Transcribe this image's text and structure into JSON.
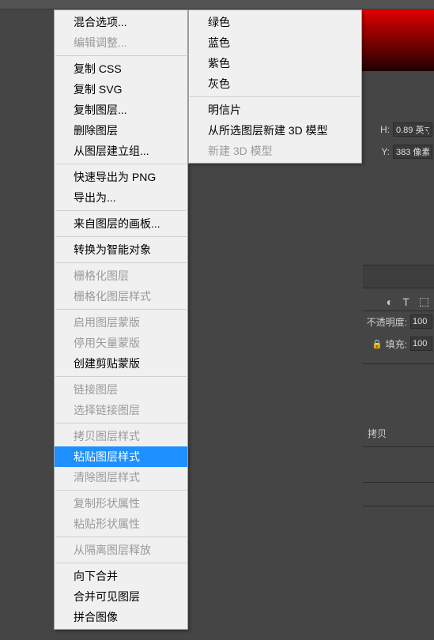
{
  "right_panel": {
    "h_label": "H:",
    "h_value": "0.89 英寸",
    "y_label": "Y:",
    "y_value": "383 像素",
    "opacity_label": "不透明度:",
    "opacity_value": "100",
    "fill_label": "填充:",
    "fill_value": "100",
    "copy_label": "拷贝",
    "icons": {
      "adjust": "◐",
      "text": "T",
      "crop": "⬚"
    }
  },
  "lock_icon": "🔒",
  "menu1": {
    "items": [
      {
        "label": "混合选项...",
        "enabled": true
      },
      {
        "label": "编辑调整...",
        "enabled": false
      }
    ],
    "group2": [
      {
        "label": "复制 CSS",
        "enabled": true
      },
      {
        "label": "复制 SVG",
        "enabled": true
      },
      {
        "label": "复制图层...",
        "enabled": true
      },
      {
        "label": "删除图层",
        "enabled": true
      },
      {
        "label": "从图层建立组...",
        "enabled": true
      }
    ],
    "group3": [
      {
        "label": "快速导出为 PNG",
        "enabled": true
      },
      {
        "label": "导出为...",
        "enabled": true
      }
    ],
    "group4": [
      {
        "label": "来自图层的画板...",
        "enabled": true
      }
    ],
    "group5": [
      {
        "label": "转换为智能对象",
        "enabled": true
      }
    ],
    "group6": [
      {
        "label": "栅格化图层",
        "enabled": false
      },
      {
        "label": "栅格化图层样式",
        "enabled": false
      }
    ],
    "group7": [
      {
        "label": "启用图层蒙版",
        "enabled": false
      },
      {
        "label": "停用矢量蒙版",
        "enabled": false
      },
      {
        "label": "创建剪贴蒙版",
        "enabled": true
      }
    ],
    "group8": [
      {
        "label": "链接图层",
        "enabled": false
      },
      {
        "label": "选择链接图层",
        "enabled": false
      }
    ],
    "group9": [
      {
        "label": "拷贝图层样式",
        "enabled": false
      },
      {
        "label": "粘贴图层样式",
        "enabled": true,
        "highlighted": true
      },
      {
        "label": "清除图层样式",
        "enabled": false
      }
    ],
    "group10": [
      {
        "label": "复制形状属性",
        "enabled": false
      },
      {
        "label": "粘贴形状属性",
        "enabled": false
      }
    ],
    "group11": [
      {
        "label": "从隔离图层释放",
        "enabled": false
      }
    ],
    "group12": [
      {
        "label": "向下合并",
        "enabled": true
      },
      {
        "label": "合并可见图层",
        "enabled": true
      },
      {
        "label": "拼合图像",
        "enabled": true
      }
    ]
  },
  "menu2": {
    "group1": [
      {
        "label": "绿色",
        "enabled": true
      },
      {
        "label": "蓝色",
        "enabled": true
      },
      {
        "label": "紫色",
        "enabled": true
      },
      {
        "label": "灰色",
        "enabled": true
      }
    ],
    "group2": [
      {
        "label": "明信片",
        "enabled": true
      },
      {
        "label": "从所选图层新建 3D 模型",
        "enabled": true
      },
      {
        "label": "新建 3D 模型",
        "enabled": false
      }
    ]
  }
}
